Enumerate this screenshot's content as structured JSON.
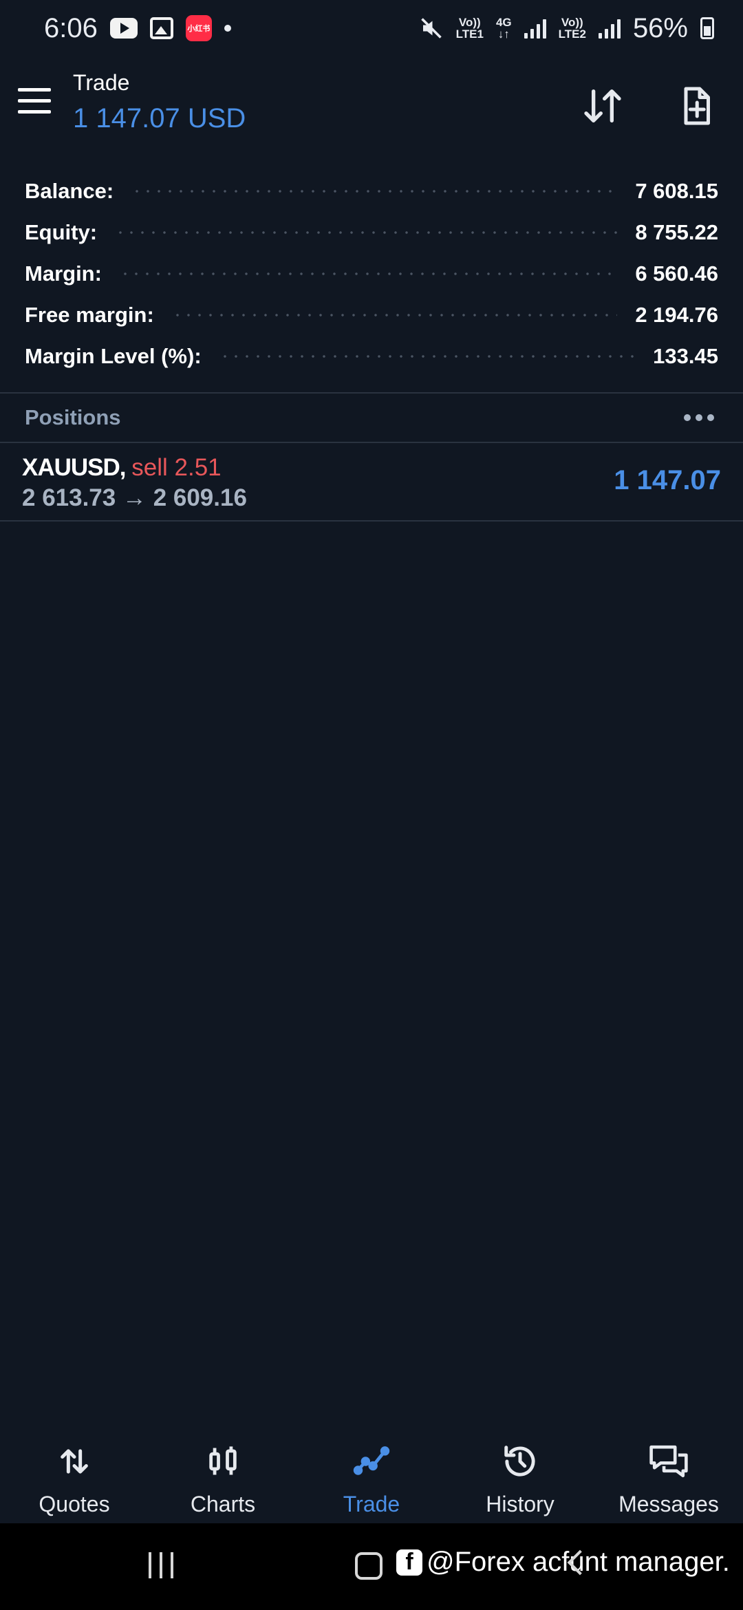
{
  "status_bar": {
    "time": "6:06",
    "app_badge": "小红书",
    "net_sim1_top": "Vo))",
    "net_sim1_bottom": "LTE1",
    "net_type_top": "4G",
    "net_type_bottom": "↓↑",
    "net_sim2_top": "Vo))",
    "net_sim2_bottom": "LTE2",
    "battery": "56%",
    "icons": [
      "youtube-icon",
      "gallery-icon",
      "app-icon",
      "mute-icon",
      "signal-icon",
      "battery-icon"
    ]
  },
  "header": {
    "title": "Trade",
    "subtitle": "1 147.07 USD"
  },
  "summary": [
    {
      "label": "Balance:",
      "value": "7 608.15"
    },
    {
      "label": "Equity:",
      "value": "8 755.22"
    },
    {
      "label": "Margin:",
      "value": "6 560.46"
    },
    {
      "label": "Free margin:",
      "value": "2 194.76"
    },
    {
      "label": "Margin Level (%):",
      "value": "133.45"
    }
  ],
  "positions": {
    "title": "Positions",
    "items": [
      {
        "symbol": "XAUUSD,",
        "side": "sell 2.51",
        "prices": "2 613.73 → 2 609.16",
        "profit": "1 147.07"
      }
    ]
  },
  "bottom_nav": [
    {
      "label": "Quotes",
      "icon": "arrows-updown-icon"
    },
    {
      "label": "Charts",
      "icon": "candlestick-icon"
    },
    {
      "label": "Trade",
      "icon": "trend-line-icon",
      "active": true
    },
    {
      "label": "History",
      "icon": "history-icon"
    },
    {
      "label": "Messages",
      "icon": "messages-icon"
    }
  ],
  "system_nav": {
    "watermark": "@Forex acfunt manager."
  },
  "colors": {
    "background": "#101722",
    "accent": "#4a8fe6",
    "sell": "#e8575a",
    "muted": "#8fa0b6"
  }
}
